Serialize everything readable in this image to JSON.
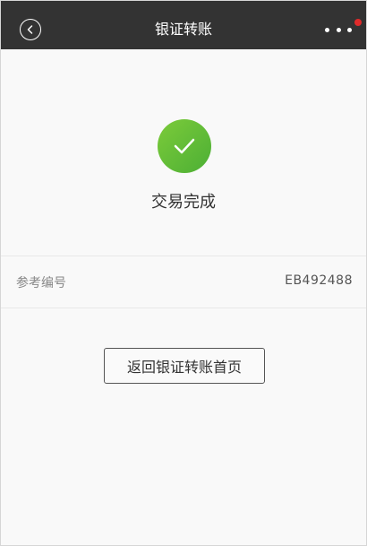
{
  "header": {
    "title": "银证转账",
    "back_icon": "back-arrow-circle-icon",
    "more_icon": "more-dots-icon",
    "badge_color": "#e02b2b"
  },
  "result": {
    "icon": "checkmark-circle-icon",
    "icon_color": "#5ab83a",
    "status_text": "交易完成"
  },
  "reference": {
    "label": "参考编号",
    "value": "EB492488"
  },
  "actions": {
    "home_button_label": "返回银证转账首页"
  }
}
